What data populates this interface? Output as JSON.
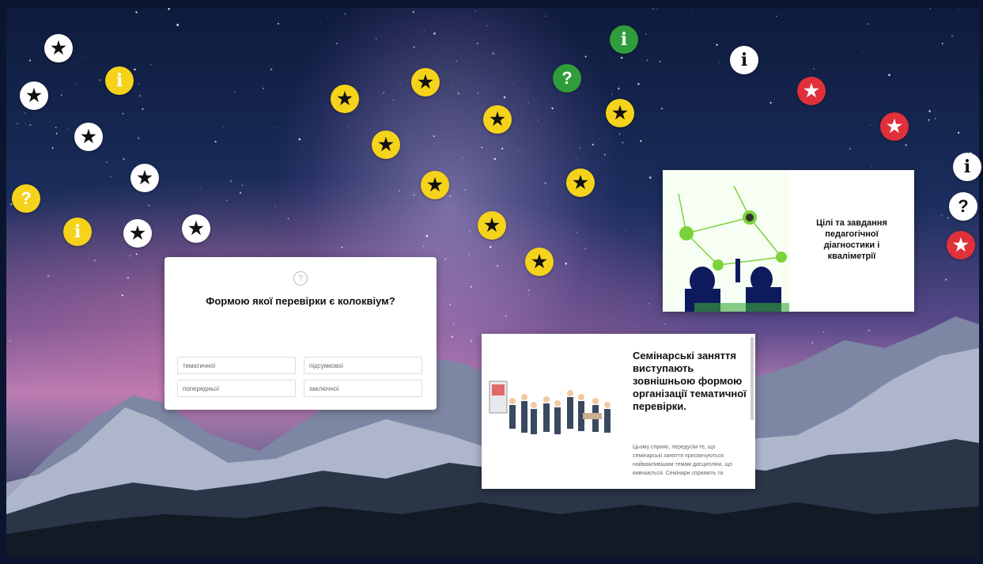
{
  "hotspots": [
    {
      "kind": "star-white",
      "glyph": "★"
    },
    {
      "kind": "star-white",
      "glyph": "★"
    },
    {
      "kind": "star-white",
      "glyph": "★"
    },
    {
      "kind": "star-white",
      "glyph": "★"
    },
    {
      "kind": "star-white",
      "glyph": "★"
    },
    {
      "kind": "star-white",
      "glyph": "★"
    },
    {
      "kind": "info-yellow",
      "glyph": "i"
    },
    {
      "kind": "info-yellow",
      "glyph": "i"
    },
    {
      "kind": "q-yellow",
      "glyph": "?"
    },
    {
      "kind": "star-yellow",
      "glyph": "★"
    },
    {
      "kind": "star-yellow",
      "glyph": "★"
    },
    {
      "kind": "star-yellow",
      "glyph": "★"
    },
    {
      "kind": "star-yellow",
      "glyph": "★"
    },
    {
      "kind": "star-yellow",
      "glyph": "★"
    },
    {
      "kind": "star-yellow",
      "glyph": "★"
    },
    {
      "kind": "star-yellow",
      "glyph": "★"
    },
    {
      "kind": "star-yellow",
      "glyph": "★"
    },
    {
      "kind": "star-yellow",
      "glyph": "★"
    },
    {
      "kind": "info-green",
      "glyph": "i"
    },
    {
      "kind": "q-green",
      "glyph": "?"
    },
    {
      "kind": "info-white",
      "glyph": "i"
    },
    {
      "kind": "star-red",
      "glyph": "★"
    },
    {
      "kind": "star-red",
      "glyph": "★"
    },
    {
      "kind": "info-white",
      "glyph": "i"
    },
    {
      "kind": "q-white",
      "glyph": "?"
    },
    {
      "kind": "star-red",
      "glyph": "★"
    }
  ],
  "quiz": {
    "title": "Формою якої перевірки є колоквіум?",
    "options": [
      "тематичної",
      "підсумкової",
      "попередньої",
      "заключної"
    ]
  },
  "card_diagnostics": {
    "title": "Цілі та завдання педагогічної діагностики і кваліметрії"
  },
  "card_seminar": {
    "title": "Семінарські заняття виступають зовнішньою формою організації тематичної перевірки.",
    "body": "Цьому сприяє, передусім те, що семінарські заняття присвячуються найважливішим темам дисципліни, що вивчаються. Семінари сприяють та"
  },
  "colors": {
    "yellow": "#f5d31a",
    "red": "#e0303a",
    "green": "#2f9d3a",
    "white": "#ffffff"
  }
}
